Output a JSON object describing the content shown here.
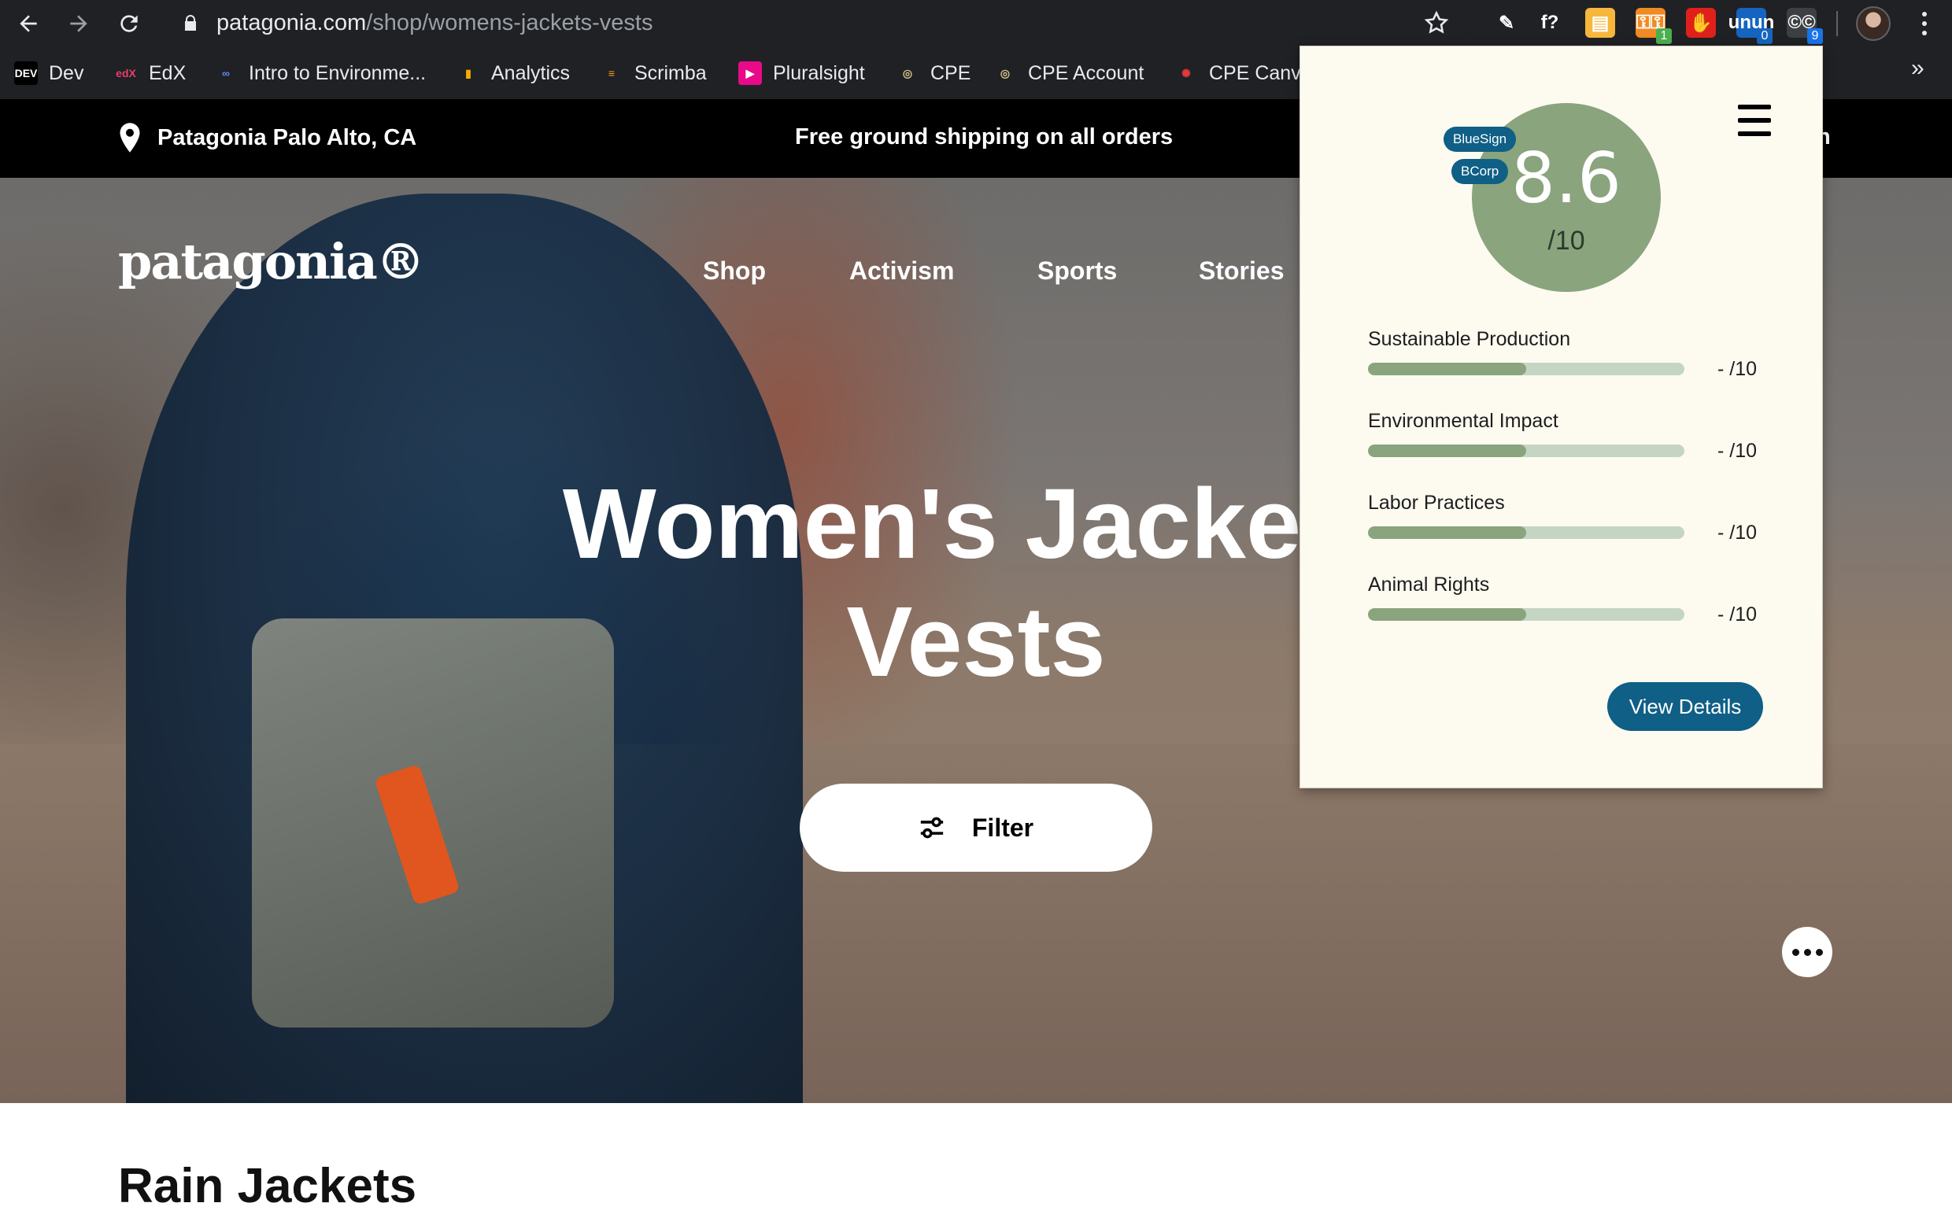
{
  "browser": {
    "url_host": "patagonia.com",
    "url_path": "/shop/womens-jackets-vests",
    "extensions": [
      {
        "name": "pen-extension-icon",
        "glyph": "✎",
        "badge": "",
        "color": "#202124",
        "badge_color": "#1a73e8"
      },
      {
        "name": "formula-extension-icon",
        "glyph": "f?",
        "badge": "",
        "color": "#202124",
        "badge_color": ""
      },
      {
        "name": "notes-extension-icon",
        "glyph": "▤",
        "badge": "",
        "color": "#f6b73c",
        "badge_color": ""
      },
      {
        "name": "key-extension-icon",
        "glyph": "⚿",
        "badge": "1",
        "color": "#f08a24",
        "badge_color": "#4caf50"
      },
      {
        "name": "hand-extension-icon",
        "glyph": "✋",
        "badge": "",
        "color": "#e0201b",
        "badge_color": ""
      },
      {
        "name": "unlisted-extension-icon",
        "glyph": "un",
        "badge": "0",
        "color": "#1565c0",
        "badge_color": "#1565c0"
      },
      {
        "name": "rating-extension-icon",
        "glyph": "©",
        "badge": "9",
        "color": "#3c4043",
        "badge_color": "#1a73e8"
      }
    ]
  },
  "bookmarks": [
    {
      "label": "Dev",
      "icon": "DEV",
      "icon_bg": "#000000",
      "icon_color": "#ffffff"
    },
    {
      "label": "EdX",
      "icon": "edX",
      "icon_bg": "#202124",
      "icon_color": "#e63d6d"
    },
    {
      "label": "Intro to Environme...",
      "icon": "∞",
      "icon_bg": "#202124",
      "icon_color": "#5b8def"
    },
    {
      "label": "Analytics",
      "icon": "▮",
      "icon_bg": "#202124",
      "icon_color": "#f9ab00"
    },
    {
      "label": "Scrimba",
      "icon": "≡",
      "icon_bg": "#202124",
      "icon_color": "#f6a11b"
    },
    {
      "label": "Pluralsight",
      "icon": "▶",
      "icon_bg": "#e80a89",
      "icon_color": "#ffffff"
    },
    {
      "label": "CPE",
      "icon": "◎",
      "icon_bg": "#202124",
      "icon_color": "#d4c48a"
    },
    {
      "label": "CPE Account",
      "icon": "◎",
      "icon_bg": "#202124",
      "icon_color": "#d4c48a"
    },
    {
      "label": "CPE Canv",
      "icon": "✺",
      "icon_bg": "#202124",
      "icon_color": "#e23a3a"
    }
  ],
  "bookmarks_overflow": "»",
  "promo": {
    "store": "Patagonia Palo Alto, CA",
    "shipping": "Free ground shipping on all orders",
    "right_fragment": "n"
  },
  "site": {
    "logo": "patagonia®",
    "nav": [
      "Shop",
      "Activism",
      "Sports",
      "Stories"
    ],
    "hero_title_line1": "Women's Jackets",
    "hero_title_line2": "Vests",
    "filter_label": "Filter",
    "section_heading": "Rain Jackets"
  },
  "extension_popup": {
    "score": "8.6",
    "score_denominator": "/10",
    "certifications": [
      "BlueSign",
      "BCorp"
    ],
    "categories": [
      {
        "label": "Sustainable Production",
        "score": "- /10",
        "fill_fraction": 0.5
      },
      {
        "label": "Environmental Impact",
        "score": "- /10",
        "fill_fraction": 0.5
      },
      {
        "label": "Labor Practices",
        "score": "- /10",
        "fill_fraction": 0.5
      },
      {
        "label": "Animal Rights",
        "score": "- /10",
        "fill_fraction": 0.5
      }
    ],
    "details_button": "View Details",
    "accent_color": "#8aa47d",
    "button_color": "#0f5f86"
  }
}
